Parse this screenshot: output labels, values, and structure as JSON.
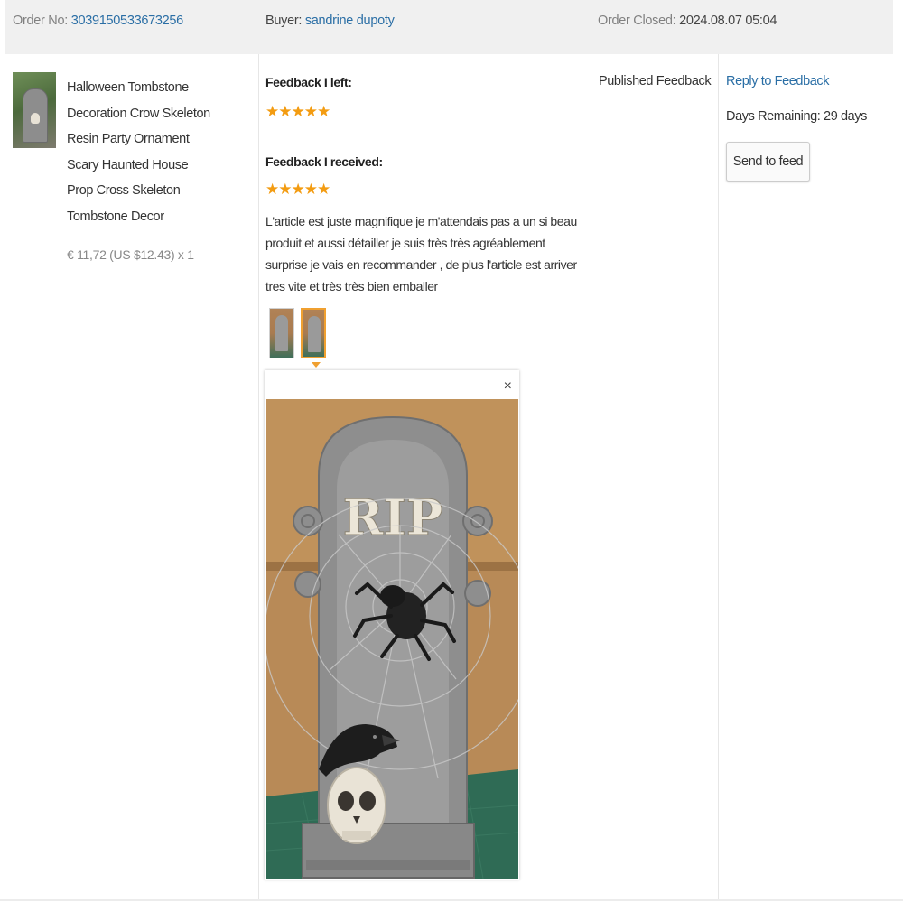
{
  "header": {
    "order_label": "Order No:",
    "order_number": "3039150533673256",
    "buyer_label": "Buyer:",
    "buyer_name": "sandrine dupoty",
    "closed_label": "Order Closed:",
    "closed_date": "2024.08.07 05:04"
  },
  "product": {
    "title_lines": [
      "Halloween Tombstone",
      "Decoration Crow Skeleton",
      "Resin Party Ornament",
      "Scary Haunted House",
      "Prop Cross Skeleton",
      "Tombstone Decor"
    ],
    "price": "€ 11,72 (US $12.43) x 1"
  },
  "feedback": {
    "left_label": "Feedback I left:",
    "left_rating": 5,
    "left_stars": "★★★★★",
    "received_label": "Feedback I received:",
    "received_rating": 5,
    "received_stars": "★★★★★",
    "review_text": "L'article est juste magnifique je m'attendais pas a un si beau produit et aussi détailler je suis très très agréablement surprise je vais en recommander , de plus l'article est arriver tres vite et très très bien emballer",
    "close_symbol": "×",
    "photo_text": "RIP"
  },
  "published": {
    "label": "Published Feedback"
  },
  "actions": {
    "reply_label": "Reply to Feedback",
    "days_remaining": "Days Remaining: 29 days",
    "send_button": "Send to feed"
  },
  "colors": {
    "link": "#2a6ea5",
    "star": "#f39c12",
    "header_bg": "#f0f0f0",
    "active_thumb_border": "#f0a030"
  }
}
